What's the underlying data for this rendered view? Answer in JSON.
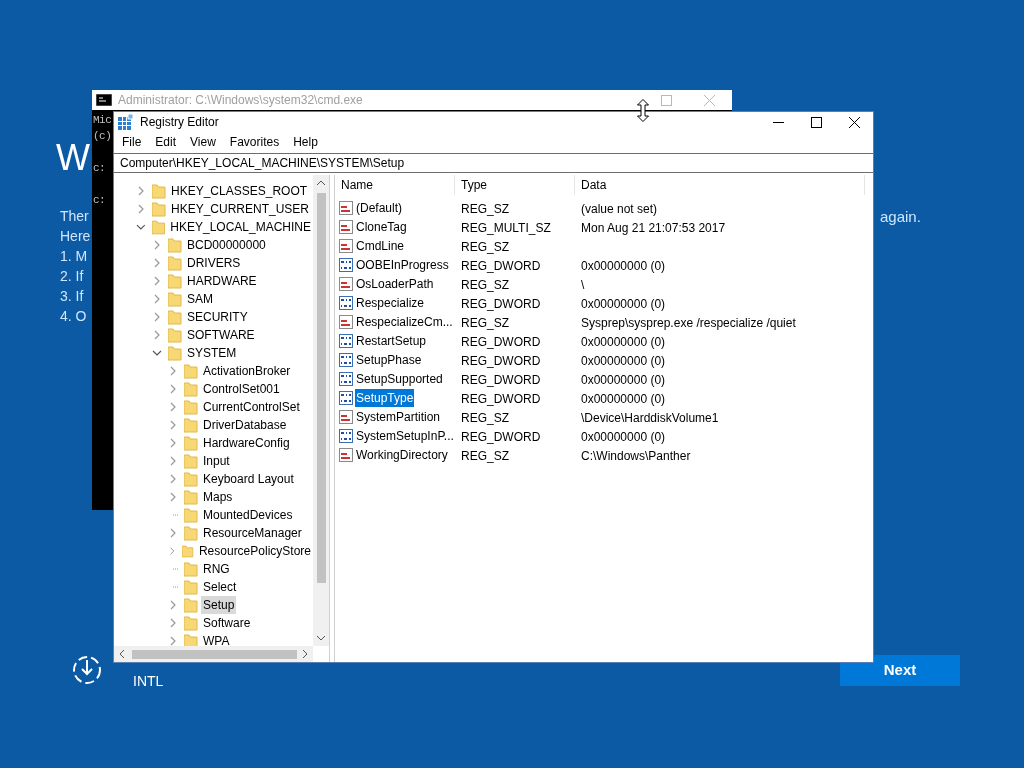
{
  "setup": {
    "heading": "W",
    "lines": [
      "Ther",
      "Here",
      "1. M",
      "2. If",
      "3. If",
      "4. O"
    ],
    "line_end": "again.",
    "keyboard_layout": "INTL",
    "next_button": "Next"
  },
  "console": {
    "title": "Administrator: C:\\Windows\\system32\\cmd.exe",
    "lines": [
      "Mic",
      "(c)",
      "c:",
      "c:"
    ]
  },
  "registry": {
    "title": "Registry Editor",
    "menu": [
      "File",
      "Edit",
      "View",
      "Favorites",
      "Help"
    ],
    "address": "Computer\\HKEY_LOCAL_MACHINE\\SYSTEM\\Setup",
    "tree": [
      {
        "label": "HKEY_CLASSES_ROOT",
        "expandable": true,
        "expanded": false,
        "selected": false
      },
      {
        "label": "HKEY_CURRENT_USER",
        "expandable": true,
        "expanded": false,
        "selected": false
      },
      {
        "label": "HKEY_LOCAL_MACHINE",
        "expandable": true,
        "expanded": true,
        "selected": false,
        "children": [
          {
            "label": "BCD00000000",
            "expandable": true,
            "expanded": false,
            "selected": false
          },
          {
            "label": "DRIVERS",
            "expandable": true,
            "expanded": false,
            "selected": false
          },
          {
            "label": "HARDWARE",
            "expandable": true,
            "expanded": false,
            "selected": false
          },
          {
            "label": "SAM",
            "expandable": true,
            "expanded": false,
            "selected": false
          },
          {
            "label": "SECURITY",
            "expandable": true,
            "expanded": false,
            "selected": false
          },
          {
            "label": "SOFTWARE",
            "expandable": true,
            "expanded": false,
            "selected": false
          },
          {
            "label": "SYSTEM",
            "expandable": true,
            "expanded": true,
            "selected": false,
            "children": [
              {
                "label": "ActivationBroker",
                "expandable": true,
                "expanded": false,
                "selected": false
              },
              {
                "label": "ControlSet001",
                "expandable": true,
                "expanded": false,
                "selected": false
              },
              {
                "label": "CurrentControlSet",
                "expandable": true,
                "expanded": false,
                "selected": false
              },
              {
                "label": "DriverDatabase",
                "expandable": true,
                "expanded": false,
                "selected": false
              },
              {
                "label": "HardwareConfig",
                "expandable": true,
                "expanded": false,
                "selected": false
              },
              {
                "label": "Input",
                "expandable": true,
                "expanded": false,
                "selected": false
              },
              {
                "label": "Keyboard Layout",
                "expandable": true,
                "expanded": false,
                "selected": false
              },
              {
                "label": "Maps",
                "expandable": true,
                "expanded": false,
                "selected": false
              },
              {
                "label": "MountedDevices",
                "expandable": false,
                "expanded": false,
                "selected": false
              },
              {
                "label": "ResourceManager",
                "expandable": true,
                "expanded": false,
                "selected": false
              },
              {
                "label": "ResourcePolicyStore",
                "expandable": true,
                "expanded": false,
                "selected": false
              },
              {
                "label": "RNG",
                "expandable": false,
                "expanded": false,
                "selected": false
              },
              {
                "label": "Select",
                "expandable": false,
                "expanded": false,
                "selected": false
              },
              {
                "label": "Setup",
                "expandable": true,
                "expanded": false,
                "selected": true
              },
              {
                "label": "Software",
                "expandable": true,
                "expanded": false,
                "selected": false
              },
              {
                "label": "WPA",
                "expandable": true,
                "expanded": false,
                "selected": false
              }
            ]
          }
        ]
      }
    ],
    "columns": [
      "Name",
      "Type",
      "Data"
    ],
    "values": [
      {
        "kind": "string",
        "name": "(Default)",
        "type": "REG_SZ",
        "data": "(value not set)",
        "selected": false
      },
      {
        "kind": "string",
        "name": "CloneTag",
        "type": "REG_MULTI_SZ",
        "data": "Mon Aug 21 21:07:53 2017",
        "selected": false
      },
      {
        "kind": "string",
        "name": "CmdLine",
        "type": "REG_SZ",
        "selected": false
      },
      {
        "kind": "binary",
        "name": "OOBEInProgress",
        "type": "REG_DWORD",
        "data": "0x00000000 (0)",
        "selected": false
      },
      {
        "kind": "string",
        "name": "OsLoaderPath",
        "type": "REG_SZ",
        "data": "\\",
        "selected": false
      },
      {
        "kind": "binary",
        "name": "Respecialize",
        "type": "REG_DWORD",
        "data": "0x00000000 (0)",
        "selected": false
      },
      {
        "kind": "string",
        "name": "RespecializeCm...",
        "type": "REG_SZ",
        "data": "Sysprep\\sysprep.exe /respecialize /quiet",
        "selected": false
      },
      {
        "kind": "binary",
        "name": "RestartSetup",
        "type": "REG_DWORD",
        "data": "0x00000000 (0)",
        "selected": false
      },
      {
        "kind": "binary",
        "name": "SetupPhase",
        "type": "REG_DWORD",
        "data": "0x00000000 (0)",
        "selected": false
      },
      {
        "kind": "binary",
        "name": "SetupSupported",
        "type": "REG_DWORD",
        "data": "0x00000000 (0)",
        "selected": false
      },
      {
        "kind": "binary",
        "name": "SetupType",
        "type": "REG_DWORD",
        "data": "0x00000000 (0)",
        "selected": true
      },
      {
        "kind": "string",
        "name": "SystemPartition",
        "type": "REG_SZ",
        "data": "\\Device\\HarddiskVolume1",
        "selected": false
      },
      {
        "kind": "binary",
        "name": "SystemSetupInP...",
        "type": "REG_DWORD",
        "data": "0x00000000 (0)",
        "selected": false
      },
      {
        "kind": "string",
        "name": "WorkingDirectory",
        "type": "REG_SZ",
        "data": "C:\\Windows\\Panther",
        "selected": false
      }
    ]
  }
}
